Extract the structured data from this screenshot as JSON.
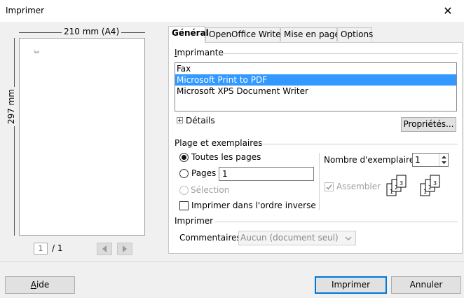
{
  "window": {
    "title": "Imprimer",
    "close": "✕"
  },
  "preview": {
    "width_label": "210 mm (A4)",
    "height_label": "297 mm",
    "page_text": "Test",
    "page_number": "1",
    "page_total": "/ 1"
  },
  "tabs": [
    {
      "label": "Général",
      "active": true
    },
    {
      "label": "OpenOffice Writer",
      "active": false
    },
    {
      "label": "Mise en page",
      "active": false
    },
    {
      "label": "Options",
      "active": false
    }
  ],
  "printer": {
    "section_label": "Imprimante",
    "items": [
      "Fax",
      "Microsoft Print to PDF",
      "Microsoft XPS Document Writer"
    ],
    "selected_index": 1,
    "details_label": "Détails",
    "properties_label": "Propriétés..."
  },
  "range": {
    "section_label": "Plage et exemplaires",
    "all_pages_label": "Toutes les pages",
    "pages_label": "Pages",
    "pages_value": "1",
    "selection_label": "Sélection",
    "reverse_order_label": "Imprimer dans l'ordre inverse",
    "copies_label": "Nombre d'exemplaires",
    "copies_value": "1",
    "collate_label": "Assembler"
  },
  "print": {
    "section_label": "Imprimer",
    "comments_label": "Commentaires",
    "comments_value": "Aucun (document seul)"
  },
  "footer": {
    "help_label": "Aide",
    "print_label": "Imprimer",
    "cancel_label": "Annuler"
  }
}
